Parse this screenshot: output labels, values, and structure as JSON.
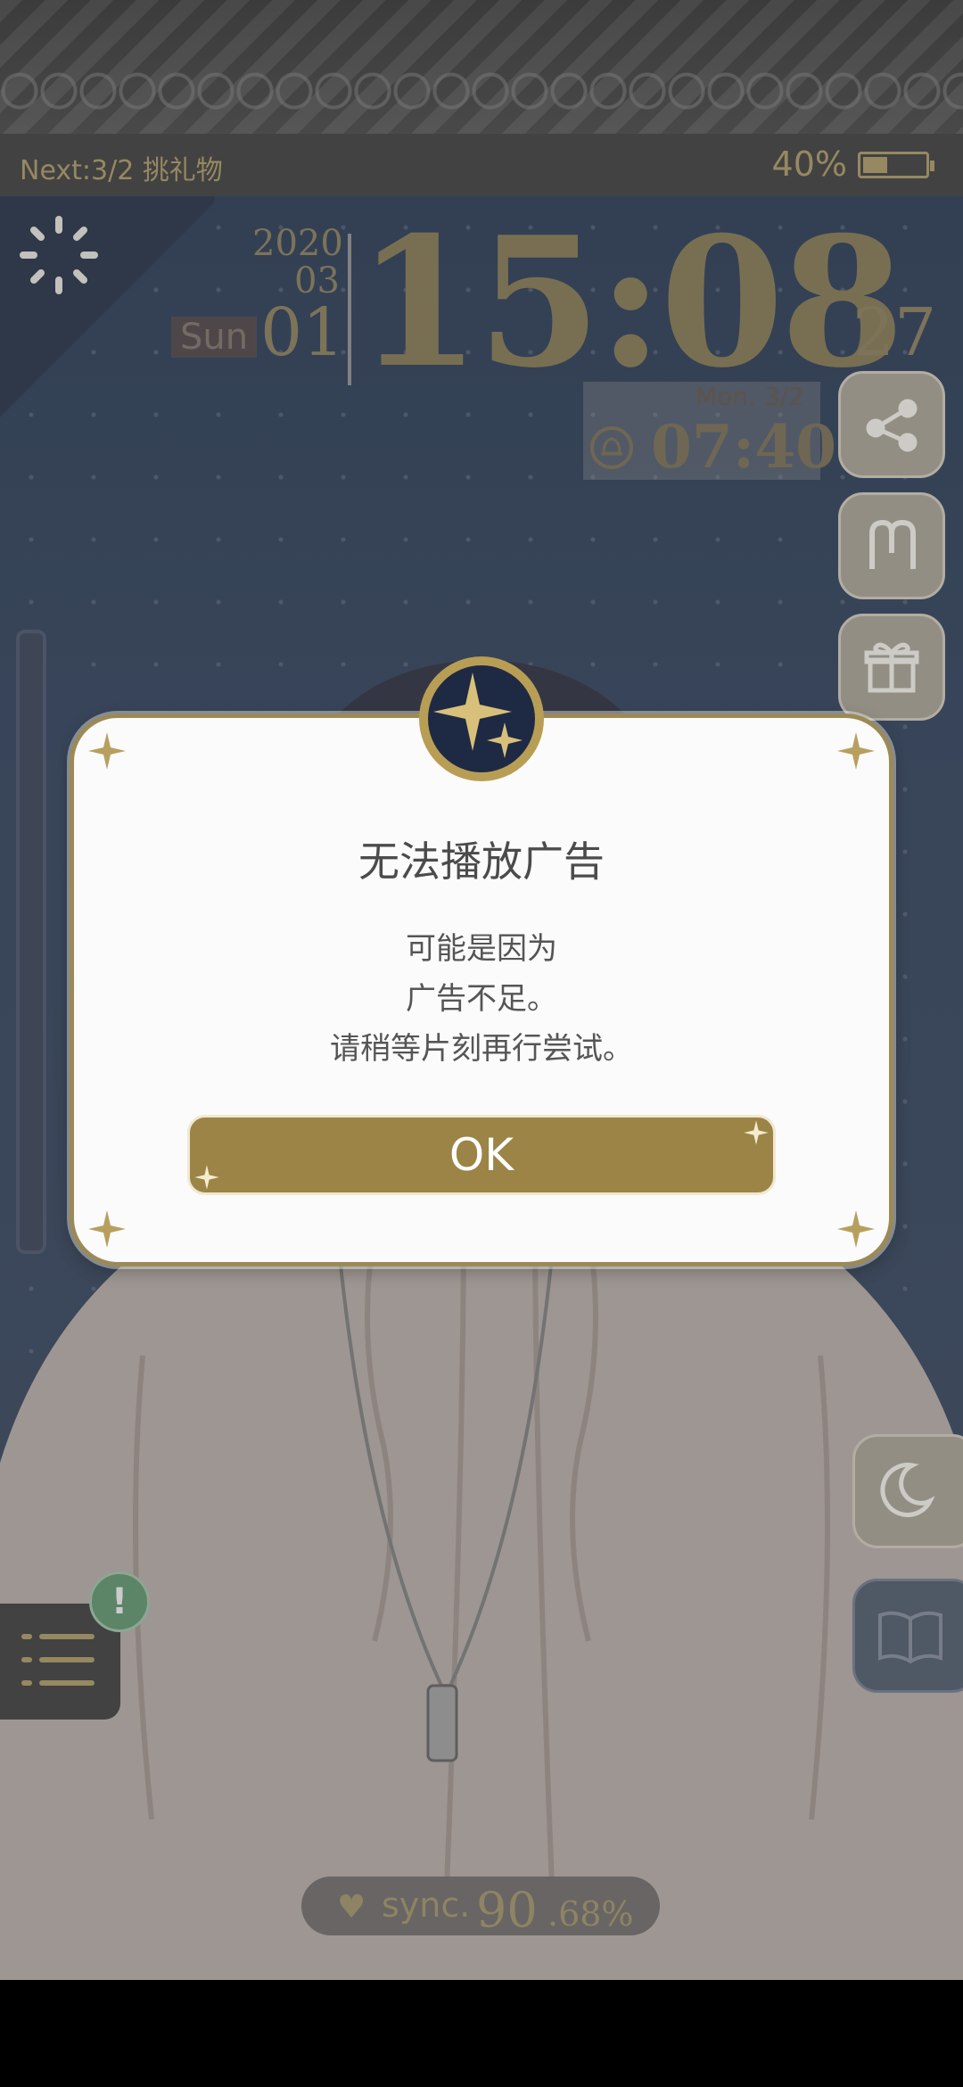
{
  "status": {
    "next_label": "Next:3/2 挑礼物",
    "battery_pct": "40%",
    "battery_level": 0.4
  },
  "clock": {
    "year": "2020",
    "month": "03",
    "day_of_week": "Sun",
    "day": "01",
    "time": "15:08",
    "seconds": "27"
  },
  "alarm": {
    "day": "Mon.  3/2",
    "time": "07:40"
  },
  "side_buttons": {
    "icons": [
      "share-icon",
      "constellation-icon",
      "gift-icon",
      "moon-icon",
      "book-icon"
    ]
  },
  "sync": {
    "label": "sync.",
    "value_big": "90",
    "value_small": ".68%"
  },
  "dialog": {
    "title": "无法播放广告",
    "body_line1": "可能是因为",
    "body_line2": "广告不足。",
    "body_line3": "请稍等片刻再行尝试。",
    "ok_label": "OK"
  },
  "notice_mark": "!",
  "colors": {
    "gold": "#9b8446",
    "dialog_border": "#9b8a56",
    "background": "#44536b"
  }
}
